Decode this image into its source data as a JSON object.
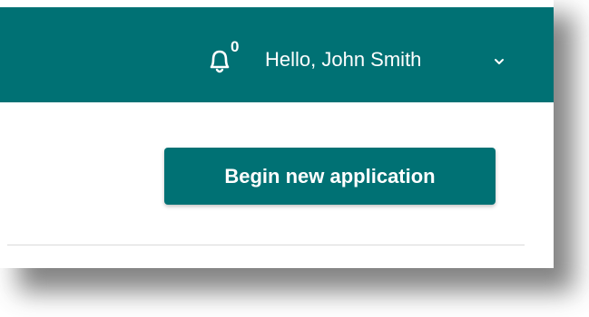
{
  "header": {
    "notifications": {
      "icon": "bell-icon",
      "count": "0"
    },
    "user_menu": {
      "greeting": "Hello, John Smith",
      "icon": "chevron-down-icon"
    }
  },
  "main": {
    "begin_button_label": "Begin new application"
  },
  "colors": {
    "brand": "#007174",
    "text_on_brand": "#ffffff",
    "divider": "#dadada"
  }
}
